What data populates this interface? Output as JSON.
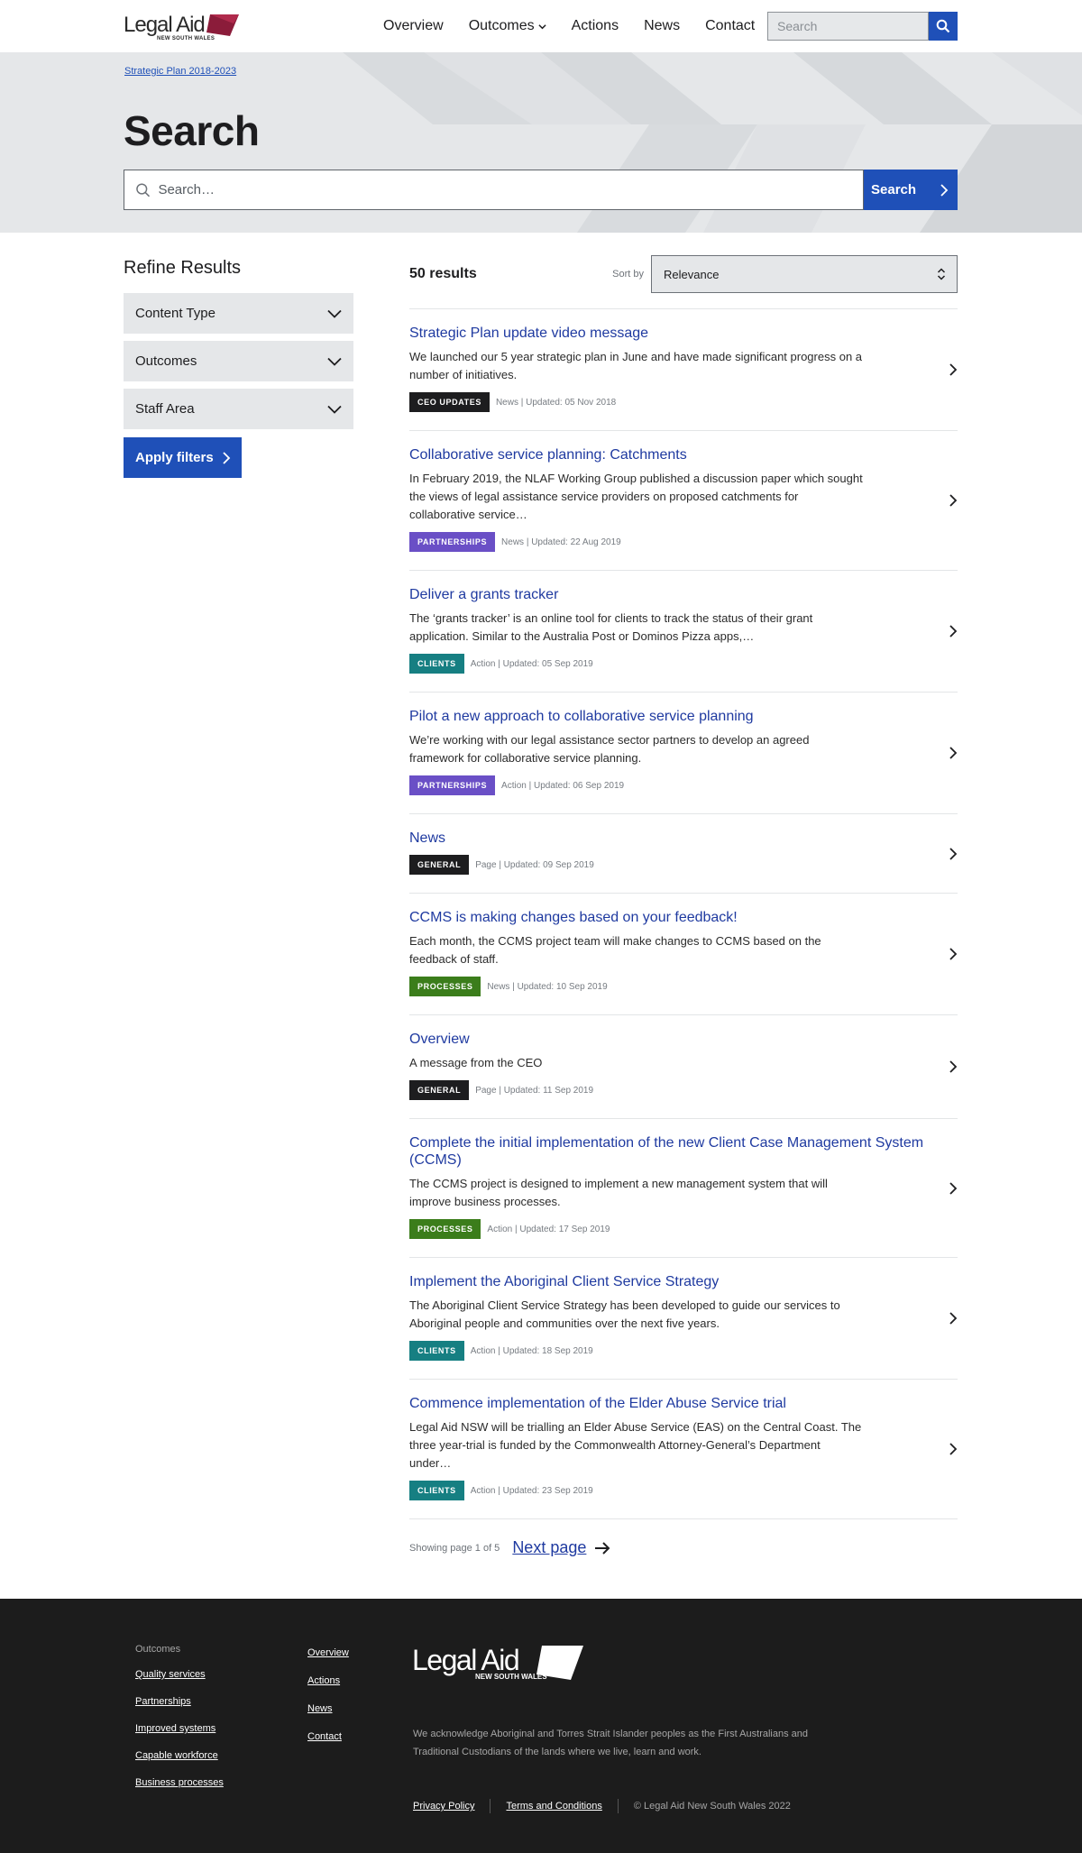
{
  "header": {
    "logo_text": "Legal Aid",
    "logo_sub": "NEW SOUTH WALES",
    "nav": [
      "Overview",
      "Outcomes",
      "Actions",
      "News",
      "Contact"
    ],
    "search_placeholder": "Search"
  },
  "hero": {
    "breadcrumb": "Strategic Plan 2018-2023",
    "title": "Search",
    "search_placeholder": "Search…",
    "search_button": "Search"
  },
  "sidebar": {
    "title": "Refine Results",
    "filters": [
      "Content Type",
      "Outcomes",
      "Staff Area"
    ],
    "apply": "Apply filters"
  },
  "results": {
    "count": "50 results",
    "sort_label": "Sort by",
    "sort_value": "Relevance",
    "items": [
      {
        "title": "Strategic Plan update video message",
        "desc": "We launched our 5 year strategic plan in June and have made significant progress on a number of initiatives.",
        "badge": "CEO UPDATES",
        "meta": "News | Updated: 05 Nov 2018"
      },
      {
        "title": "Collaborative service planning: Catchments",
        "desc": "In February 2019, the NLAF Working Group published a discussion paper which sought the views of legal assistance service providers on proposed catchments for collaborative service…",
        "badge": "PARTNERSHIPS",
        "meta": "News | Updated: 22 Aug 2019"
      },
      {
        "title": "Deliver a grants tracker",
        "desc": "The ‘grants tracker’ is an online tool for clients to track the status of their grant application. Similar to the Australia Post or Dominos Pizza apps,…",
        "badge": "CLIENTS",
        "meta": "Action | Updated: 05 Sep 2019"
      },
      {
        "title": "Pilot a new approach to collaborative service planning",
        "desc": "We’re working with our legal assistance sector partners to develop an agreed framework for collaborative service planning.",
        "badge": "PARTNERSHIPS",
        "meta": "Action | Updated: 06 Sep 2019"
      },
      {
        "title": "News",
        "desc": "",
        "badge": "GENERAL",
        "meta": "Page | Updated: 09 Sep 2019"
      },
      {
        "title": "CCMS is making changes based on your feedback!",
        "desc": "Each month, the CCMS project team will make changes to CCMS based on the feedback of staff.",
        "badge": "PROCESSES",
        "meta": "News | Updated: 10 Sep 2019"
      },
      {
        "title": "Overview",
        "desc": "A message from the CEO",
        "badge": "GENERAL",
        "meta": "Page | Updated: 11 Sep 2019"
      },
      {
        "title": "Complete the initial implementation of the new Client Case Management System (CCMS)",
        "desc": "The CCMS project is designed to implement a new management system that will improve business processes.",
        "badge": "PROCESSES",
        "meta": "Action | Updated: 17 Sep 2019"
      },
      {
        "title": "Implement the Aboriginal Client Service Strategy",
        "desc": "The Aboriginal Client Service Strategy has been developed to guide our services to Aboriginal people and communities over the next five years.",
        "badge": "CLIENTS",
        "meta": "Action | Updated: 18 Sep 2019"
      },
      {
        "title": "Commence implementation of the Elder Abuse Service trial",
        "desc": "Legal Aid NSW will be trialling an Elder Abuse Service (EAS) on the Central Coast. The three year-trial is funded by the Commonwealth Attorney-General’s Department under…",
        "badge": "CLIENTS",
        "meta": "Action | Updated: 23 Sep 2019"
      }
    ],
    "pager_text": "Showing page 1 of 5",
    "next": "Next page"
  },
  "badge_colors": {
    "CEO UPDATES": "#1d1d1f",
    "PARTNERSHIPS": "#6a4fc6",
    "CLIENTS": "#167f82",
    "GENERAL": "#1d1d1f",
    "PROCESSES": "#3b7d1b"
  },
  "footer": {
    "outcomes_heading": "Outcomes",
    "outcomes_links": [
      "Quality services",
      "Partnerships",
      "Improved systems",
      "Capable workforce",
      "Business processes"
    ],
    "nav_links": [
      "Overview",
      "Actions",
      "News",
      "Contact"
    ],
    "logo_text": "Legal Aid",
    "logo_sub": "NEW SOUTH WALES",
    "acknowledgement": "We acknowledge Aboriginal and Torres Strait Islander peoples as the First Australians and Traditional Custodians of the lands where we live, learn and work.",
    "privacy": "Privacy Policy",
    "terms": "Terms and Conditions",
    "copyright": "© Legal Aid New South Wales 2022"
  },
  "colors": {
    "accent": "#1f50b8",
    "link": "#1f3aa0",
    "logo_mark": "#8b1c3a",
    "hero_bg": "#e5e7e9",
    "footer_bg": "#1c1c1c"
  }
}
